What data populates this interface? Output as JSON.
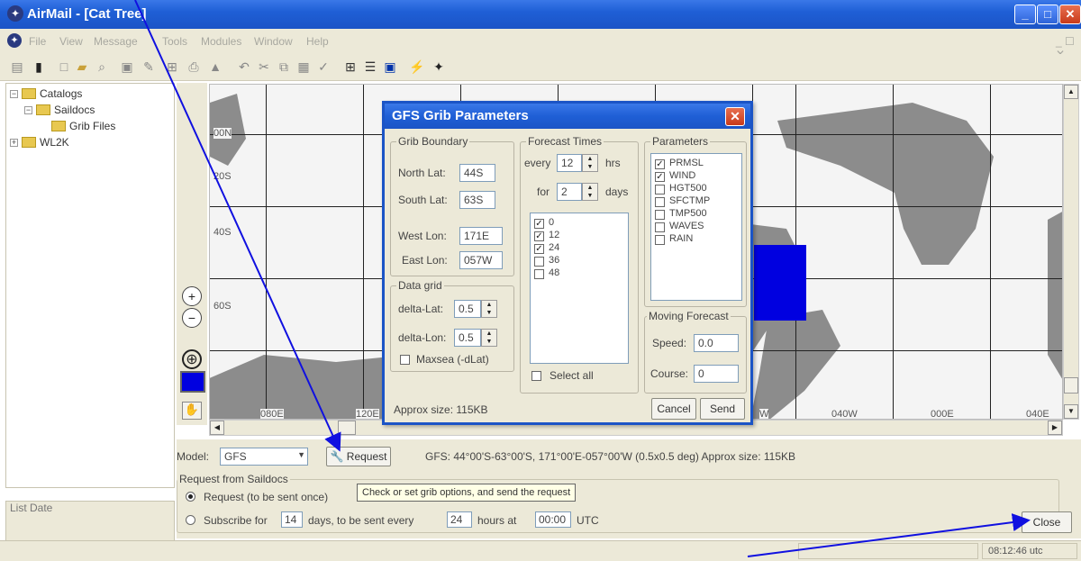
{
  "window": {
    "title": "AirMail - [Cat Tree]"
  },
  "menu": [
    "File",
    "View",
    "Message",
    "Tools",
    "Modules",
    "Window",
    "Help"
  ],
  "tree": {
    "catalogs": "Catalogs",
    "saildocs": "Saildocs",
    "grib_files": "Grib Files",
    "wl2k": "WL2K"
  },
  "list_date_label": "List Date",
  "map": {
    "lat_labels": [
      "00N",
      "20S",
      "40S",
      "60S"
    ],
    "lon_labels": [
      "080E",
      "120E",
      "040W",
      "000E",
      "040E"
    ],
    "partial_w": "W"
  },
  "dialog": {
    "title": "GFS Grib Parameters",
    "grib_boundary": {
      "label": "Grib Boundary",
      "north_label": "North Lat:",
      "north": "44S",
      "south_label": "South Lat:",
      "south": "63S",
      "west_label": "West Lon:",
      "west": "171E",
      "east_label": "East Lon:",
      "east": "057W"
    },
    "data_grid": {
      "label": "Data grid",
      "dlat_label": "delta-Lat:",
      "dlat": "0.5",
      "dlon_label": "delta-Lon:",
      "dlon": "0.5",
      "maxsea_label": "Maxsea (-dLat)"
    },
    "forecast": {
      "label": "Forecast Times",
      "every_label": "every",
      "every": "12",
      "hrs": "hrs",
      "for_label": "for",
      "for": "2",
      "days": "days",
      "times": [
        {
          "label": "0",
          "checked": true
        },
        {
          "label": "12",
          "checked": true
        },
        {
          "label": "24",
          "checked": true
        },
        {
          "label": "36",
          "checked": false
        },
        {
          "label": "48",
          "checked": false
        }
      ],
      "select_all": "Select all"
    },
    "parameters": {
      "label": "Parameters",
      "items": [
        {
          "label": "PRMSL",
          "checked": true
        },
        {
          "label": "WIND",
          "checked": true
        },
        {
          "label": "HGT500",
          "checked": false
        },
        {
          "label": "SFCTMP",
          "checked": false
        },
        {
          "label": "TMP500",
          "checked": false
        },
        {
          "label": "WAVES",
          "checked": false
        },
        {
          "label": "RAIN",
          "checked": false
        }
      ]
    },
    "moving": {
      "label": "Moving Forecast",
      "speed_label": "Speed:",
      "speed": "0.0",
      "course_label": "Course:",
      "course": "0"
    },
    "approx": "Approx size: 115KB",
    "cancel": "Cancel",
    "send": "Send"
  },
  "bottom": {
    "model_label": "Model:",
    "model": "GFS",
    "request_button": "Request",
    "summary": "GFS: 44°00'S-63°00'S, 171°00'E-057°00'W (0.5x0.5 deg)  Approx size: 115KB",
    "request_from": "Request from Saildocs",
    "once": "Request (to be sent once)",
    "subscribe_pre": "Subscribe for",
    "sub_days": "14",
    "sub_mid": "days,  to be sent every",
    "sub_hours": "24",
    "sub_mid2": "hours  at",
    "sub_time": "00:00",
    "utc": "UTC",
    "close": "Close",
    "tooltip": "Check or set grib options, and send the request"
  },
  "status": {
    "time": "08:12:46 utc"
  },
  "colors": {
    "title_blue": "#1f5fd6",
    "land": "#8c8c8c",
    "selection": "#0000e0",
    "arrow": "#1010e0"
  }
}
